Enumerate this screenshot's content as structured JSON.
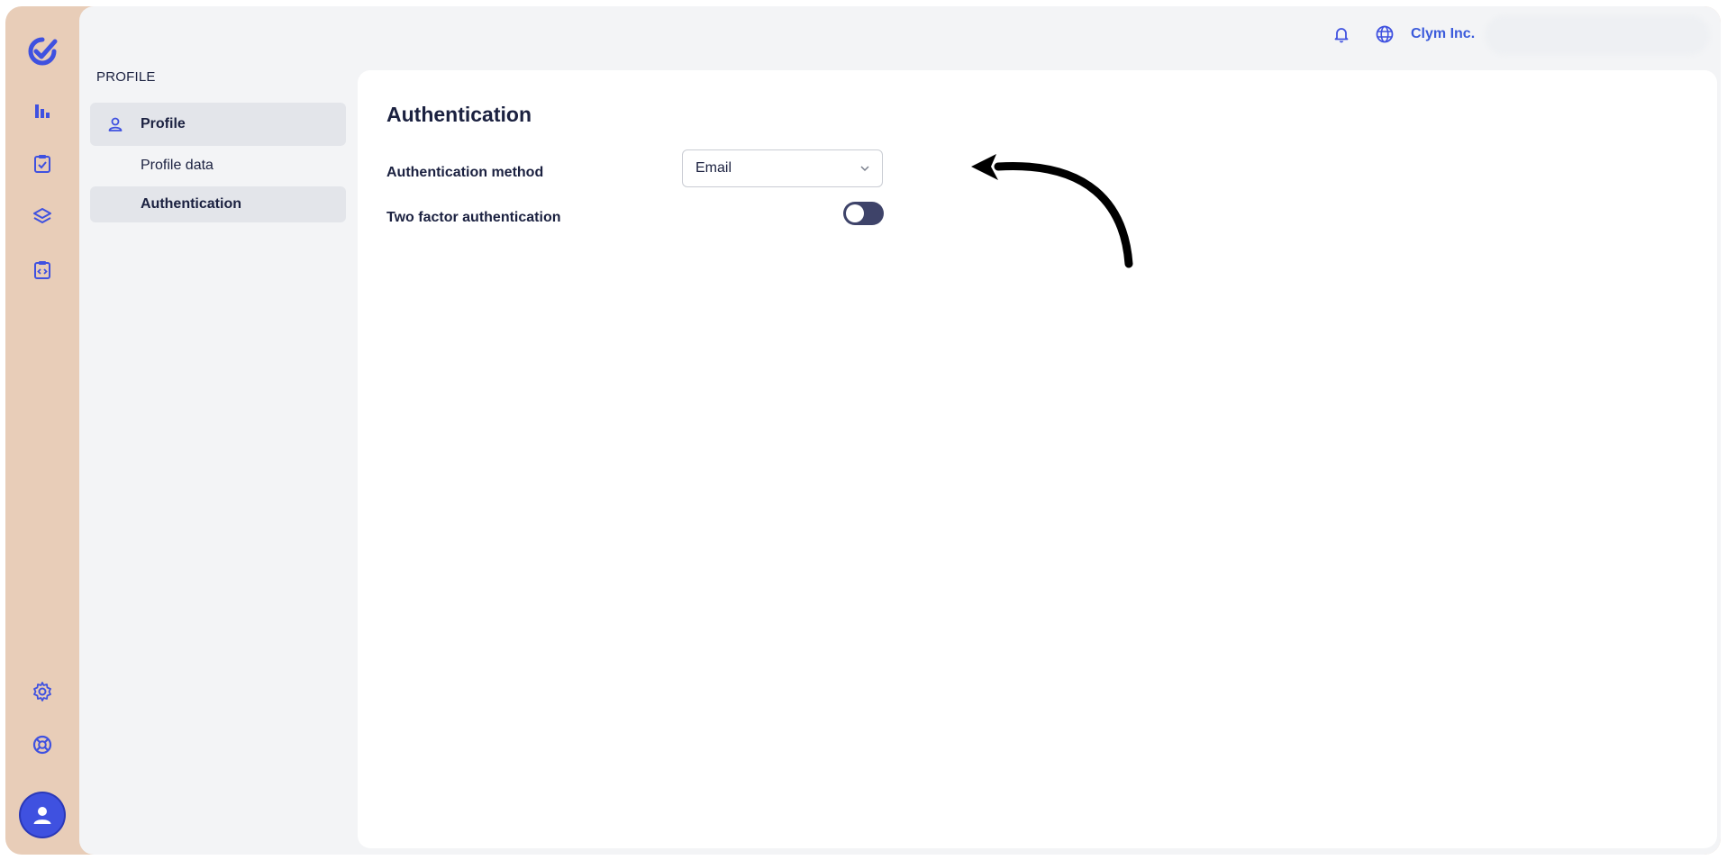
{
  "topbar": {
    "org_name": "Clym Inc."
  },
  "sidenav": {
    "section_title": "PROFILE",
    "main_item": "Profile",
    "sub_items": [
      "Profile data",
      "Authentication"
    ],
    "active_sub": "Authentication"
  },
  "panel": {
    "title": "Authentication",
    "auth_method_label": "Authentication method",
    "auth_method_value": "Email",
    "two_factor_label": "Two factor authentication",
    "two_factor_enabled": false
  },
  "colors": {
    "brand": "#3f51e0",
    "accent_text": "#3b5bdb",
    "toggle_off": "#3e4369",
    "frame": "#e8cdb8"
  },
  "icons": {
    "rail_top": [
      "logo-icon",
      "chart-bar-icon",
      "clipboard-check-icon",
      "layers-icon",
      "code-clipboard-icon"
    ],
    "rail_bottom": [
      "gear-icon",
      "lifebuoy-icon",
      "user-avatar-icon"
    ],
    "topbar": [
      "bell-icon",
      "globe-icon"
    ]
  }
}
